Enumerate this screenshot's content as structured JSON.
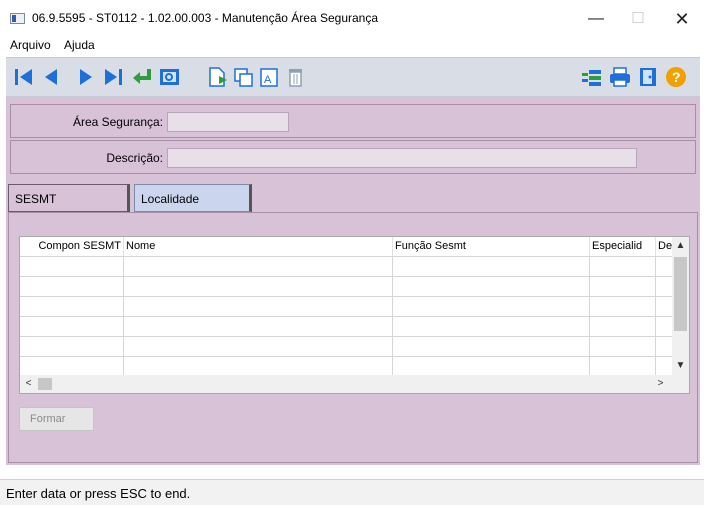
{
  "window": {
    "title": "06.9.5595 - ST0112 - 1.02.00.003 - Manutenção Área Segurança",
    "minimize": "—",
    "maximize": "☐",
    "close": "✕"
  },
  "menu": [
    "Arquivo",
    "Ajuda"
  ],
  "toolbar": {
    "left_icons": [
      "first-record-icon",
      "previous-record-icon",
      "next-record-icon",
      "last-record-icon",
      "return-icon",
      "search-icon",
      "new-record-icon",
      "copy-icon",
      "edit-icon",
      "delete-icon"
    ],
    "right_icons": [
      "list-icon",
      "print-icon",
      "exit-door-icon",
      "help-icon"
    ]
  },
  "form": {
    "area_label": "Área Segurança:",
    "area_value": "",
    "descricao_label": "Descrição:",
    "descricao_value": ""
  },
  "tabs": [
    {
      "label": "SESMT",
      "active": true
    },
    {
      "label": "Localidade",
      "active": false
    }
  ],
  "grid": {
    "columns": [
      "Compon SESMT",
      "Nome",
      "Função Sesmt",
      "Especialid",
      "De"
    ],
    "rows": [
      [
        "",
        "",
        "",
        "",
        ""
      ],
      [
        "",
        "",
        "",
        "",
        ""
      ],
      [
        "",
        "",
        "",
        "",
        ""
      ],
      [
        "",
        "",
        "",
        "",
        ""
      ],
      [
        "",
        "",
        "",
        "",
        ""
      ],
      [
        "",
        "",
        "",
        "",
        ""
      ]
    ],
    "scroll_up": "▲",
    "scroll_down": "▼",
    "scroll_left": "<",
    "scroll_right": ">"
  },
  "button_formar": "Formar",
  "status": "Enter data or press ESC to end.",
  "colors": {
    "form_bg": "#d8c2d8",
    "toolbar_bg": "#d9dde5",
    "icon_blue": "#1e6fd9",
    "icon_green": "#2e9e3a",
    "help_orange": "#f0a000"
  }
}
